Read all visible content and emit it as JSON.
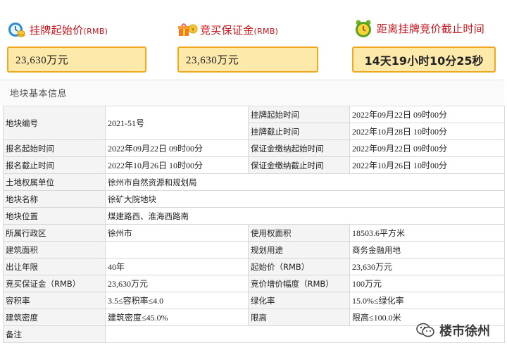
{
  "header": {
    "start_price": {
      "title": "挂牌起始价",
      "unit": "(RMB)",
      "value": "23,630万元"
    },
    "deposit": {
      "title": "竞买保证金",
      "unit": "(RMB)",
      "value": "23,630万元"
    },
    "deadline": {
      "title": "距离挂牌竞价截止时间",
      "countdown": "14天19小时10分25秒"
    }
  },
  "section": {
    "title": "地块基本信息"
  },
  "table": {
    "r1": {
      "l1": "地块编号",
      "v1": "2021-51号",
      "l2a": "挂牌起始时间",
      "v2a": "2022年09月22日 09时00分",
      "l2b": "挂牌截止时间",
      "v2b": "2022年10月28日 10时00分"
    },
    "r2": {
      "l1": "报名起始时间",
      "v1": "2022年09月22日 09时00分",
      "l2": "保证金缴纳起始时间",
      "v2": "2022年09月22日 09时00分"
    },
    "r3": {
      "l1": "报名截止时间",
      "v1": "2022年10月26日 10时00分",
      "l2": "保证金缴纳截止时间",
      "v2": "2022年10月26日 10时00分"
    },
    "r4": {
      "l1": "土地权属单位",
      "v1": "徐州市自然资源和规划局"
    },
    "r5": {
      "l1": "地块名称",
      "v1": "徐矿大院地块"
    },
    "r6": {
      "l1": "地块位置",
      "v1": "煤建路西、淮海西路南"
    },
    "r7": {
      "l1": "所属行政区",
      "v1": "徐州市",
      "l2": "使用权面积",
      "v2": "18503.6平方米"
    },
    "r8": {
      "l1": "建筑面积",
      "v1": "",
      "l2": "规划用途",
      "v2": "商务金融用地"
    },
    "r9": {
      "l1": "出让年限",
      "v1": "40年",
      "l2": "起始价（RMB）",
      "v2": "23,630万元"
    },
    "r10": {
      "l1": "竞买保证金（RMB）",
      "v1": "23,630万元",
      "l2": "竞价增价幅度（RMB）",
      "v2": "100万元"
    },
    "r11": {
      "l1": "容积率",
      "v1": "3.5≤容积率≤4.0",
      "l2": "绿化率",
      "v2": "15.0%≤绿化率"
    },
    "r12": {
      "l1": "建筑密度",
      "v1": "建筑密度≤45.0%",
      "l2": "限高",
      "v2": "限高≤100.0米"
    },
    "r13": {
      "l1": "备注",
      "v1": ""
    }
  },
  "watermark": {
    "text": "楼市徐州"
  },
  "colors": {
    "accent_red": "#c8161d",
    "box_fill": "#fde9a9",
    "box_border": "#f0a820"
  },
  "icons": [
    "money-clock-icon",
    "gift-money-icon",
    "alarm-clock-icon",
    "wechat-icon"
  ]
}
